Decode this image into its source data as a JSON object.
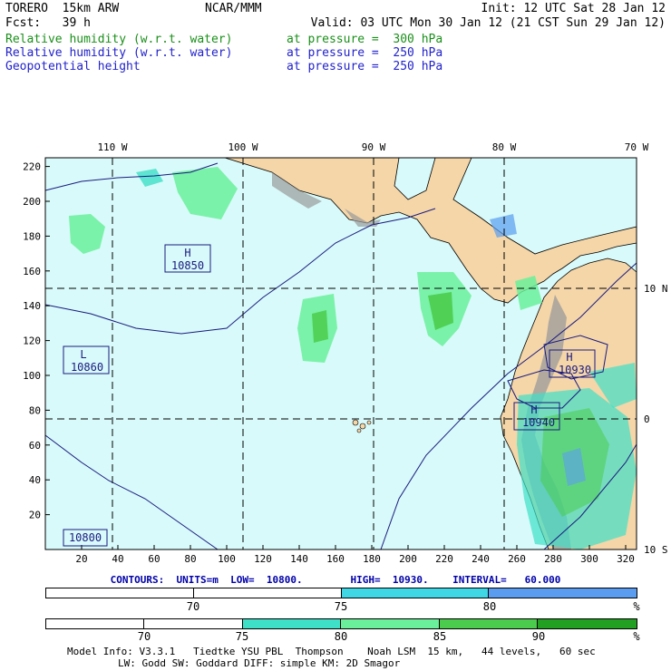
{
  "header": {
    "model": "TORERO  15km ARW",
    "org": "NCAR/MMM",
    "init": "Init: 12 UTC Sat 28 Jan 12",
    "fcst": "Fcst:   39 h",
    "valid": "Valid: 03 UTC Mon 30 Jan 12 (21 CST Sun 29 Jan 12)",
    "fields": [
      {
        "name": "Relative humidity (w.r.t. water)",
        "level": "at pressure =  300 hPa",
        "color": "#1a8f1a"
      },
      {
        "name": "Relative humidity (w.r.t. water)",
        "level": "at pressure =  250 hPa",
        "color": "#2222cc"
      },
      {
        "name": "Geopotential height",
        "level": "at pressure =  250 hPa",
        "color": "#2222cc"
      }
    ]
  },
  "map": {
    "lon_labels": [
      "110 W",
      "100 W",
      "90 W",
      "80 W",
      "70 W"
    ],
    "lat_labels": [
      "10 N",
      "0",
      "10 S"
    ],
    "y_ticks": [
      "220",
      "200",
      "180",
      "160",
      "140",
      "120",
      "100",
      "80",
      "60",
      "40",
      "20"
    ],
    "x_ticks": [
      "20",
      "40",
      "60",
      "80",
      "100",
      "120",
      "140",
      "160",
      "180",
      "200",
      "220",
      "240",
      "260",
      "280",
      "300",
      "320"
    ],
    "centers": [
      {
        "type": "H",
        "value": "10850"
      },
      {
        "type": "L",
        "value": "10860"
      },
      {
        "type": "H",
        "value": "10930"
      },
      {
        "type": "H",
        "value": "10940"
      },
      {
        "type": "",
        "value": "10800"
      }
    ],
    "colors": {
      "ocean": "#d8fafa",
      "land": "#f5d6a8",
      "mountain": "#9a9a9a",
      "contour": "#1a1a80"
    }
  },
  "contours": {
    "text": "CONTOURS:  UNITS=m  LOW=  10800.        HIGH=  10930.    INTERVAL=   60.000"
  },
  "colorbar1": {
    "labels": [
      "70",
      "75",
      "80",
      "%"
    ],
    "colors": [
      "#ffffff",
      "#ffffff",
      "#3fd6e6",
      "#5a9cf0"
    ]
  },
  "colorbar2": {
    "labels": [
      "70",
      "75",
      "80",
      "85",
      "90",
      "%"
    ],
    "colors": [
      "#ffffff",
      "#ffffff",
      "#3fe0c8",
      "#6af09a",
      "#4ccc4c",
      "#22a022"
    ]
  },
  "footer": {
    "line1": "Model Info: V3.3.1   Tiedtke YSU PBL  Thompson    Noah LSM  15 km,   44 levels,   60 sec",
    "line2": "LW: Godd SW: Goddard DIFF: simple KM: 2D Smagor"
  }
}
